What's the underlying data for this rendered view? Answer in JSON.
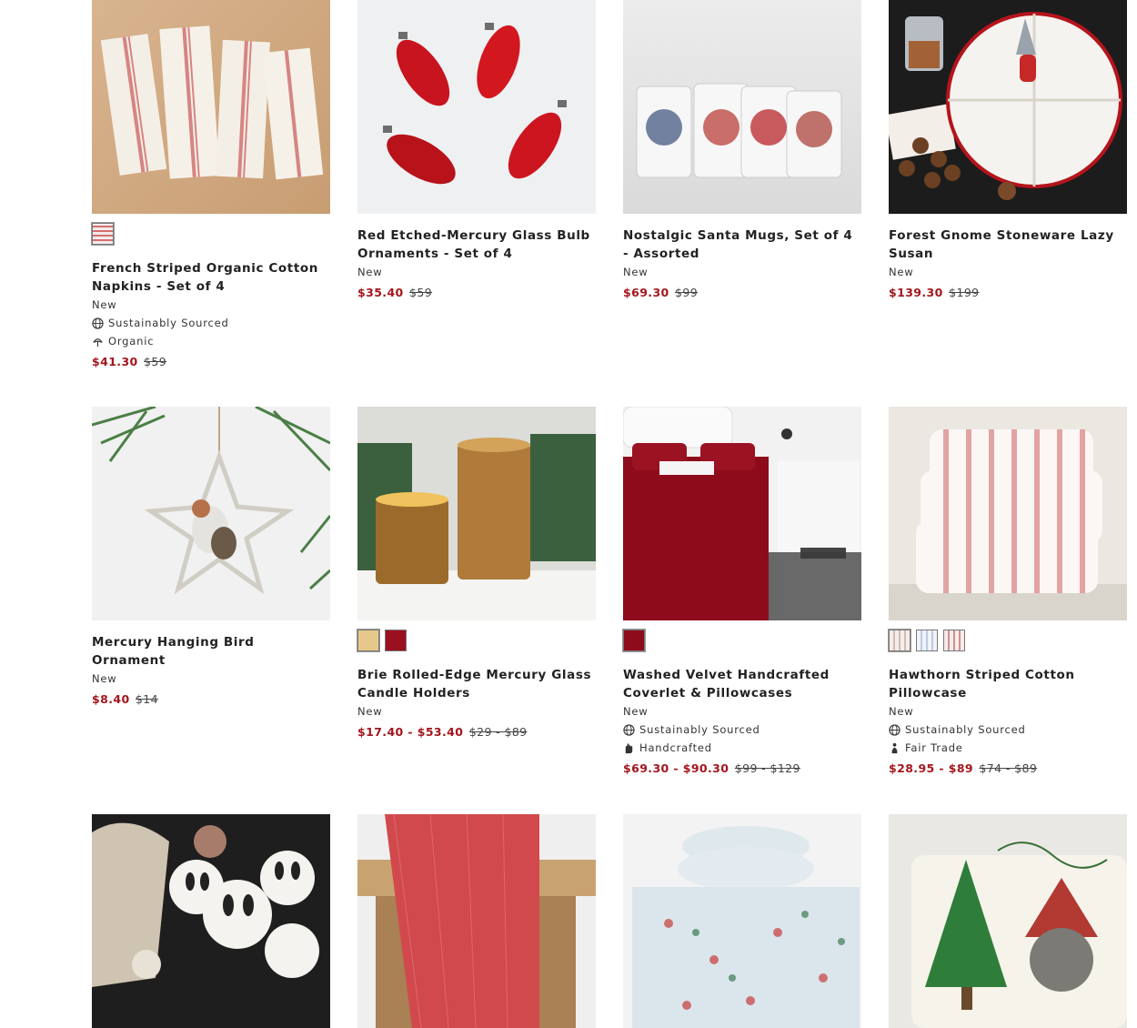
{
  "colors": {
    "sale": "#a4161d",
    "text": "#222222"
  },
  "products": [
    {
      "title": "French Striped Organic Cotton Napkins - Set of 4",
      "tag": "New",
      "attributes": [
        {
          "icon": "globe-icon",
          "label": "Sustainably Sourced"
        },
        {
          "icon": "leaf-icon",
          "label": "Organic"
        }
      ],
      "sale_price": "$41.30",
      "orig_price": "$59",
      "swatches": [
        "#e9c7c7"
      ]
    },
    {
      "title": "Red Etched-Mercury Glass Bulb Ornaments - Set of 4",
      "tag": "New",
      "attributes": [],
      "sale_price": "$35.40",
      "orig_price": "$59",
      "swatches": []
    },
    {
      "title": "Nostalgic Santa Mugs, Set of 4 - Assorted",
      "tag": "New",
      "attributes": [],
      "sale_price": "$69.30",
      "orig_price": "$99",
      "swatches": []
    },
    {
      "title": "Forest Gnome Stoneware Lazy Susan",
      "tag": "New",
      "attributes": [],
      "sale_price": "$139.30",
      "orig_price": "$199",
      "swatches": []
    },
    {
      "title": "Mercury Hanging Bird Ornament",
      "tag": "New",
      "attributes": [],
      "sale_price": "$8.40",
      "orig_price": "$14",
      "swatches": []
    },
    {
      "title": "Brie Rolled-Edge Mercury Glass Candle Holders",
      "tag": "New",
      "attributes": [],
      "sale_price": "$17.40 - $53.40",
      "orig_price": "$29 - $89",
      "swatches": [
        "#e6c98a",
        "#9b1020"
      ]
    },
    {
      "title": "Washed Velvet Handcrafted Coverlet & Pillowcases",
      "tag": "New",
      "attributes": [
        {
          "icon": "globe-icon",
          "label": "Sustainably Sourced"
        },
        {
          "icon": "hand-icon",
          "label": "Handcrafted"
        }
      ],
      "sale_price": "$69.30 - $90.30",
      "orig_price": "$99 - $129",
      "swatches": [
        "#8e0b1c"
      ]
    },
    {
      "title": "Hawthorn Striped Cotton Pillowcase",
      "tag": "New",
      "attributes": [
        {
          "icon": "globe-icon",
          "label": "Sustainably Sourced"
        },
        {
          "icon": "fair-trade-icon",
          "label": "Fair Trade"
        }
      ],
      "sale_price": "$28.95 - $89",
      "orig_price": "$74 - $89",
      "swatches": [
        "#ecdcd8",
        "#e4e8f0",
        "#e8c8c8"
      ]
    },
    {
      "title": "",
      "tag": "",
      "attributes": [],
      "sale_price": "",
      "orig_price": "",
      "swatches": []
    },
    {
      "title": "",
      "tag": "",
      "attributes": [],
      "sale_price": "",
      "orig_price": "",
      "swatches": []
    },
    {
      "title": "",
      "tag": "",
      "attributes": [],
      "sale_price": "",
      "orig_price": "",
      "swatches": []
    },
    {
      "title": "",
      "tag": "",
      "attributes": [],
      "sale_price": "",
      "orig_price": "",
      "swatches": []
    }
  ]
}
